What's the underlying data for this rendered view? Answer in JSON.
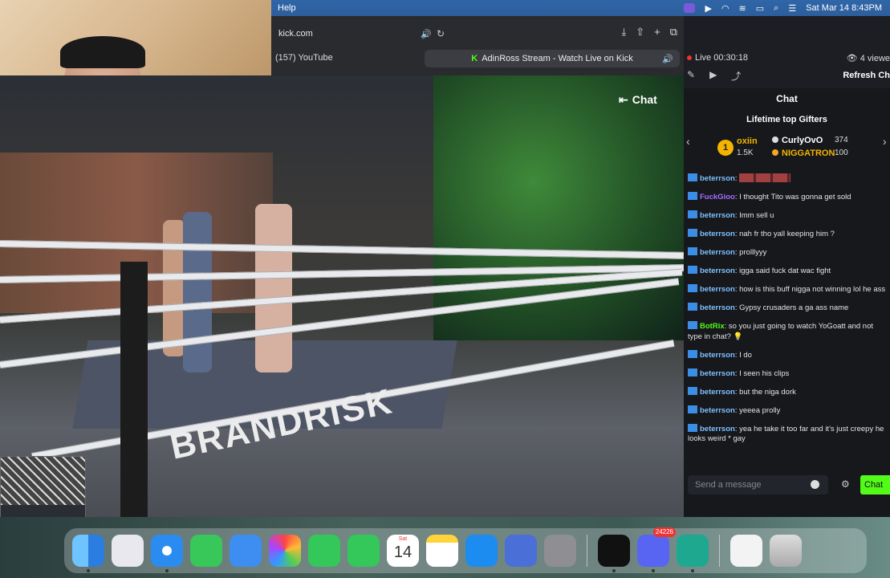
{
  "menubar": {
    "menu_item": "Help",
    "datetime": "Sat Mar 14  8:43PM"
  },
  "browser": {
    "url": "kick.com",
    "tab_youtube": "(157) YouTube",
    "tab_kick": "AdinRoss Stream - Watch Live on Kick"
  },
  "video": {
    "chat_toggle": "Chat",
    "ring_brand": "BRANDRISK"
  },
  "chat_panel": {
    "live_time": "Live 00:30:18",
    "viewers": "4 viewe",
    "refresh": "Refresh Ch",
    "title": "Chat",
    "gifters_title": "Lifetime top Gifters",
    "gifters": [
      {
        "rank": "1",
        "name": "oxiin",
        "amount": "1.5K"
      },
      {
        "name": "CurlyOvO",
        "amount": "374"
      },
      {
        "name": "NIGGATRON",
        "amount": "100"
      }
    ],
    "messages": [
      {
        "user": "beterrson",
        "text": ""
      },
      {
        "user": "FuckGioo",
        "text": "I thought Tito was gonna get sold"
      },
      {
        "user": "beterrson",
        "text": "Imm sell u"
      },
      {
        "user": "beterrson",
        "text": "nah fr tho yall keeping him ?"
      },
      {
        "user": "beterrson",
        "text": "prolllyyy"
      },
      {
        "user": "beterrson",
        "text": "igga said fuck dat wac fight"
      },
      {
        "user": "beterrson",
        "text": "how is this buff nigga not winning lol he ass"
      },
      {
        "user": "beterrson",
        "text": "Gypsy crusaders a ga ass name"
      },
      {
        "user": "BotRix",
        "text": "so you just going to watch YoGoatt and not type in chat? 💡"
      },
      {
        "user": "beterrson",
        "text": "I do"
      },
      {
        "user": "beterrson",
        "text": "I seen his clips"
      },
      {
        "user": "beterrson",
        "text": "but the niga dork"
      },
      {
        "user": "beterrson",
        "text": "yeeea prolly"
      },
      {
        "user": "beterrson",
        "text": "yea he take it too far and it's just creepy he looks weird * gay"
      }
    ],
    "input_placeholder": "Send a message",
    "send_label": "Chat"
  },
  "dock": {
    "calendar_day": "Sat",
    "calendar_date": "14",
    "discord_badge": "24226"
  },
  "colors": {
    "kick_green": "#53fc18",
    "gold": "#f5b400",
    "live_red": "#ee3333"
  }
}
